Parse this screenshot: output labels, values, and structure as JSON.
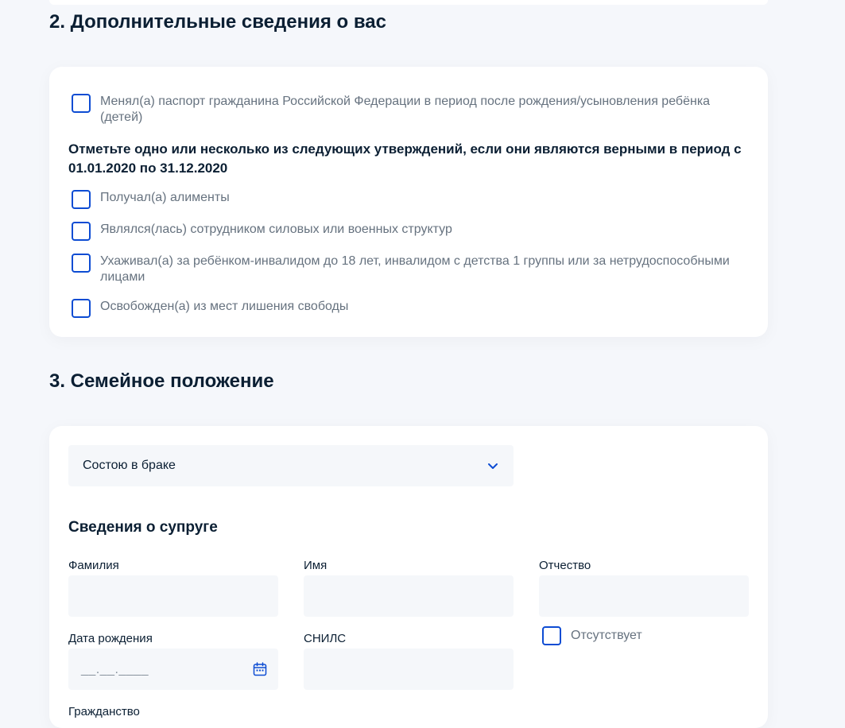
{
  "section_additional": {
    "title": "2. Дополнительные сведения о вас",
    "passport_checkbox_label": "Менял(а) паспорт гражданина Российской Федерации в период после рождения/усыновления ребёнка (детей)",
    "group_heading": "Отметьте одно или несколько из следующих утверждений, если они являются верными в период с 01.01.2020 по 31.12.2020",
    "options": [
      {
        "label": "Получал(а) алименты",
        "checked": false
      },
      {
        "label": "Являлся(лась) сотрудником силовых или военных структур",
        "checked": false
      },
      {
        "label": "Ухаживал(а) за ребёнком-инвалидом до 18 лет, инвалидом с детства 1 группы или за нетрудоспособными лицами",
        "checked": false
      },
      {
        "label": "Освобожден(а) из мест лишения свободы",
        "checked": false
      }
    ]
  },
  "section_family": {
    "title": "3. Семейное положение",
    "marital_status_select": {
      "value": "Состою в браке",
      "icon": "chevron-down-icon"
    },
    "spouse_heading": "Сведения о супруге",
    "fields": {
      "last_name_label": "Фамилия",
      "first_name_label": "Имя",
      "patronymic_label": "Отчество",
      "birth_date_label": "Дата рождения",
      "birth_date_placeholder": "__.__.____",
      "snils_label": "СНИЛС",
      "absent_label": "Отсутствует",
      "citizenship_label": "Гражданство"
    }
  },
  "colors": {
    "accent": "#0d4cd3",
    "page_background": "#f5f7fb",
    "card_background": "#ffffff",
    "input_background": "#f5f7fa",
    "muted_text": "#66727f"
  }
}
